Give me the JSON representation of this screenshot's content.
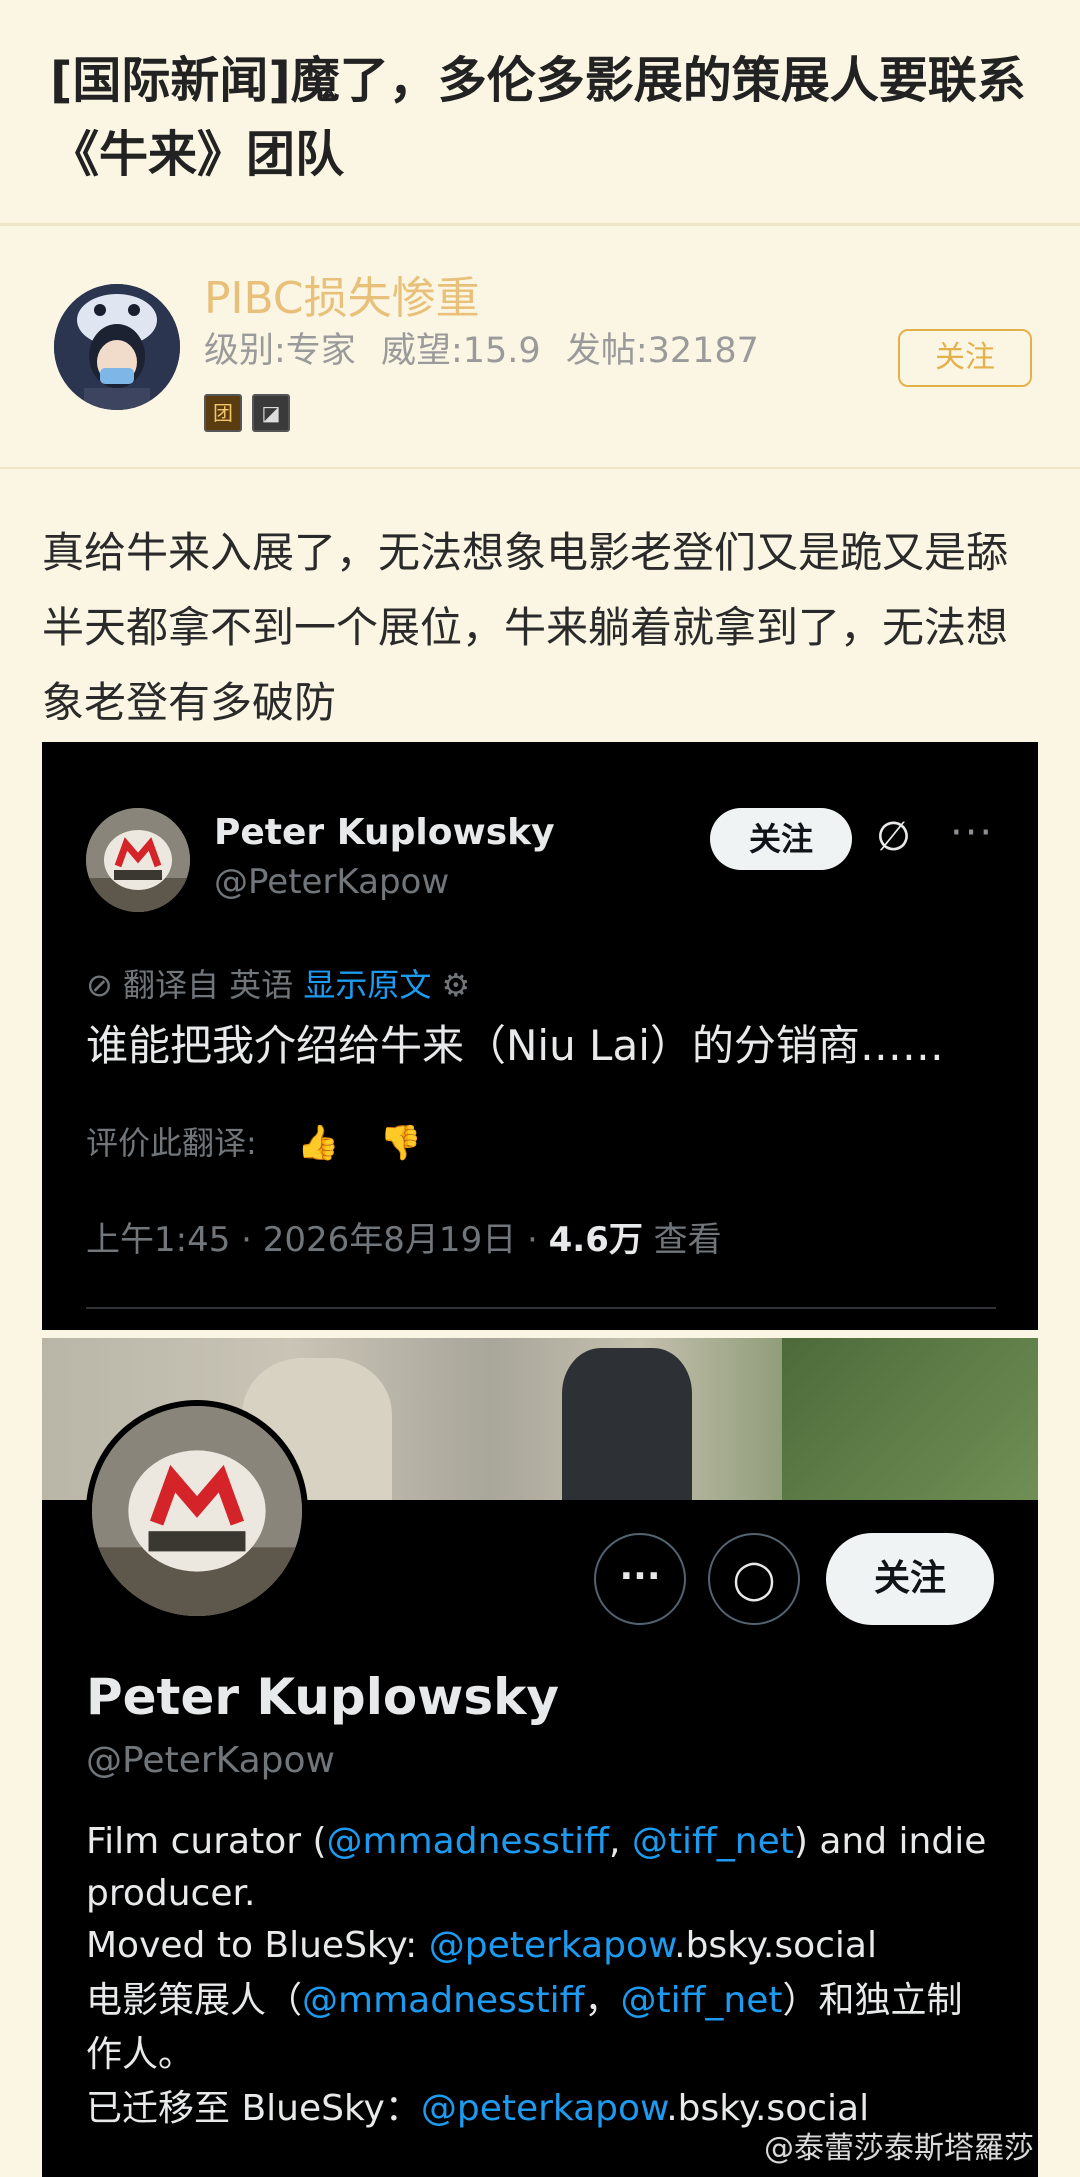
{
  "post": {
    "title": "[国际新闻]魔了，多伦多影展的策展人要联系《牛来》团队",
    "body": "真给牛来入展了，无法想象电影老登们又是跪又是舔半天都拿不到一个展位，牛来躺着就拿到了，无法想象老登有多破防"
  },
  "author": {
    "name": "PIBC损失惨重",
    "level": "级别:专家",
    "prestige": "威望:15.9",
    "posts": "发帖:32187",
    "follow_label": "关注",
    "badge1": "团",
    "badge2": "◪"
  },
  "tweet": {
    "name": "Peter Kuplowsky",
    "handle": "@PeterKapow",
    "follow_label": "关注",
    "grok_icon": "∅",
    "more_icon": "···",
    "translated_from": "翻译自 英语",
    "show_original": "显示原文",
    "settings_icon": "⚙",
    "text": "谁能把我介绍给牛来（Niu Lai）的分销商……",
    "rate_label": "评价此翻译:",
    "thumb_up": "👍",
    "thumb_down": "👎",
    "time": "上午1:45 · 2026年8月19日 · ",
    "views_count": "4.6万",
    "views_label": " 查看"
  },
  "profile": {
    "more_icon": "···",
    "message_icon": "◯",
    "follow_label": "关注",
    "name": "Peter Kuplowsky",
    "handle": "@PeterKapow",
    "bio_en_1": "Film curator (",
    "bio_en_m1": "@mmadnesstiff",
    "bio_en_2": ", ",
    "bio_en_m2": "@tiff_net",
    "bio_en_3": ") and indie producer.",
    "bio_en_4": "Moved to BlueSky: ",
    "bio_en_m3": "@peterkapow",
    "bio_en_5": ".bsky.social",
    "bio_zh_1": "电影策展人（",
    "bio_zh_m1": "@mmadnesstiff",
    "bio_zh_2": "，",
    "bio_zh_m2": "@tiff_net",
    "bio_zh_3": "）和独立制作人。",
    "bio_zh_4": "已迁移至 BlueSky：",
    "bio_zh_m3": "@peterkapow",
    "bio_zh_5": ".bsky.social"
  },
  "watermark": "@泰蕾莎泰斯塔羅莎"
}
